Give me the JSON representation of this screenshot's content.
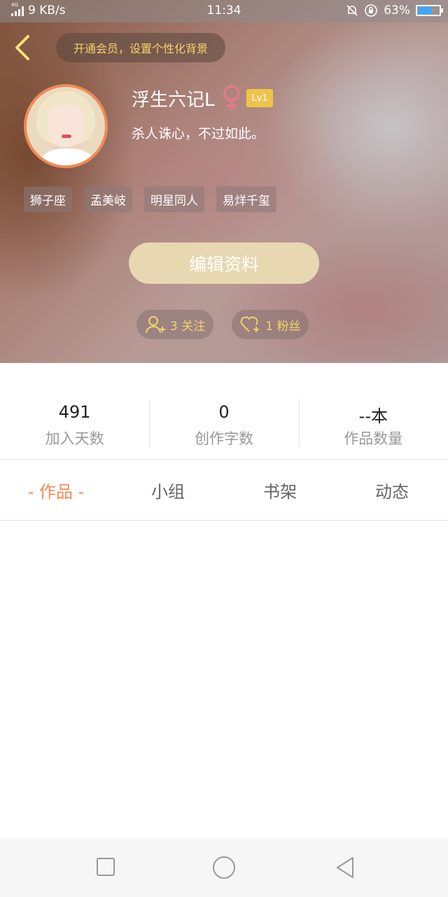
{
  "status_bar": {
    "network_type": "4G",
    "speed": "9 KB/s",
    "time": "11:34",
    "battery": "63%",
    "battery_level": 0.63
  },
  "header": {
    "vip_prompt": "开通会员，设置个性化背景",
    "username": "浮生六记L",
    "level": "Lv1",
    "bio": "杀人诛心，不过如此。",
    "tags": [
      "狮子座",
      "孟美岐",
      "明星同人",
      "易烊千玺"
    ],
    "edit_button": "编辑资料",
    "following": "3 关注",
    "followers": "1 粉丝"
  },
  "stats": [
    {
      "value": "491",
      "label": "加入天数"
    },
    {
      "value": "0",
      "label": "创作字数"
    },
    {
      "value": "--本",
      "label": "作品数量"
    }
  ],
  "tabs": [
    "- 作品 -",
    "小组",
    "书架",
    "动态"
  ],
  "colors": {
    "accent": "#f08a55",
    "gold": "#f3d36a",
    "level_badge": "#f0c34a",
    "edit_button": "#e7d8b2",
    "female_icon": "#e8788a"
  },
  "icons": {
    "back": "chevron-left-icon",
    "gender": "female-icon",
    "follow": "add-user-icon",
    "fans": "heart-plus-icon"
  }
}
